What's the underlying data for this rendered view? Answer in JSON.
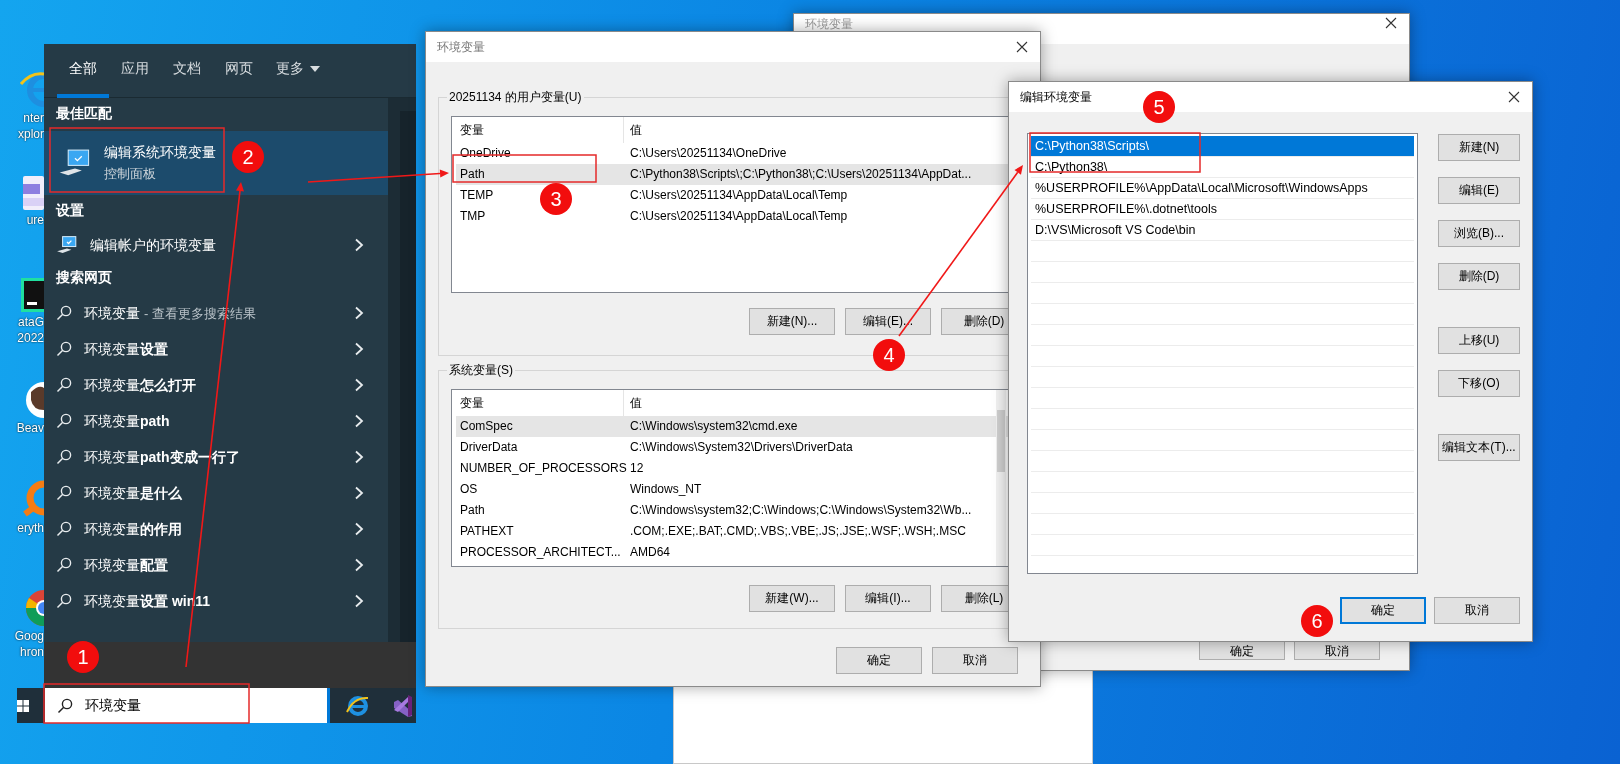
{
  "desktop": {
    "icons": [
      {
        "labels": [
          "nter",
          "xplor"
        ]
      },
      {
        "labels": [
          "ure"
        ]
      },
      {
        "labels": [
          "ataG",
          "2022"
        ]
      },
      {
        "labels": [
          "Beav"
        ]
      },
      {
        "labels": [
          "eryth"
        ]
      },
      {
        "labels": [
          "Goog",
          "hron"
        ]
      }
    ]
  },
  "start_menu": {
    "tabs": [
      {
        "label": "全部",
        "selected": true,
        "menu": false
      },
      {
        "label": "应用",
        "selected": false,
        "menu": false
      },
      {
        "label": "文档",
        "selected": false,
        "menu": false
      },
      {
        "label": "网页",
        "selected": false,
        "menu": false
      },
      {
        "label": "更多",
        "selected": false,
        "menu": true
      }
    ],
    "sections": [
      {
        "header": "最佳匹配",
        "kind": "best",
        "items": [
          {
            "title": "编辑系统环境变量",
            "subtitle": "控制面板",
            "selected": true
          }
        ]
      },
      {
        "header": "设置",
        "kind": "setting",
        "items": [
          {
            "title": "编辑帐户的环境变量"
          }
        ]
      },
      {
        "header": "搜索网页",
        "kind": "web",
        "items": [
          {
            "title": "环境变量",
            "hint": "- 查看更多搜索结果"
          },
          {
            "title": "环境变量**设置**"
          },
          {
            "title": "环境变量**怎么打开**"
          },
          {
            "title": "环境变量**path**"
          },
          {
            "title": "环境变量**path变成一行了**"
          },
          {
            "title": "环境变量**是什么**"
          },
          {
            "title": "环境变量**的作用**"
          },
          {
            "title": "环境变量**配置**"
          },
          {
            "title": "环境变量**设置 win11**"
          }
        ]
      }
    ]
  },
  "taskbar": {
    "search": {
      "value": "环境变量"
    }
  },
  "back_dialog": {
    "title": "环境变量",
    "buttons": [
      "确定",
      "取消"
    ]
  },
  "env_dialog": {
    "title": "环境变量",
    "user_group": {
      "label": "20251134 的用户变量(U)",
      "columns": [
        "变量",
        "值"
      ],
      "rows": [
        {
          "name": "OneDrive",
          "value": "C:\\Users\\20251134\\OneDrive",
          "selected": false
        },
        {
          "name": "Path",
          "value": "C:\\Python38\\Scripts\\;C:\\Python38\\;C:\\Users\\20251134\\AppDat...",
          "selected": true
        },
        {
          "name": "TEMP",
          "value": "C:\\Users\\20251134\\AppData\\Local\\Temp",
          "selected": false
        },
        {
          "name": "TMP",
          "value": "C:\\Users\\20251134\\AppData\\Local\\Temp",
          "selected": false
        }
      ],
      "buttons": [
        "新建(N)...",
        "编辑(E)...",
        "删除(D)"
      ]
    },
    "system_group": {
      "label": "系统变量(S)",
      "columns": [
        "变量",
        "值"
      ],
      "rows": [
        {
          "name": "ComSpec",
          "value": "C:\\Windows\\system32\\cmd.exe",
          "selected": true
        },
        {
          "name": "DriverData",
          "value": "C:\\Windows\\System32\\Drivers\\DriverData",
          "selected": false
        },
        {
          "name": "NUMBER_OF_PROCESSORS",
          "value": "12",
          "selected": false
        },
        {
          "name": "OS",
          "value": "Windows_NT",
          "selected": false
        },
        {
          "name": "Path",
          "value": "C:\\Windows\\system32;C:\\Windows;C:\\Windows\\System32\\Wb...",
          "selected": false
        },
        {
          "name": "PATHEXT",
          "value": ".COM;.EXE;.BAT;.CMD;.VBS;.VBE;.JS;.JSE;.WSF;.WSH;.MSC",
          "selected": false
        },
        {
          "name": "PROCESSOR_ARCHITECT...",
          "value": "AMD64",
          "selected": false
        }
      ],
      "buttons": [
        "新建(W)...",
        "编辑(I)...",
        "删除(L)"
      ]
    },
    "buttons": [
      "确定",
      "取消"
    ]
  },
  "edit_dialog": {
    "title": "编辑环境变量",
    "entries": [
      {
        "text": "C:\\Python38\\Scripts\\",
        "selected": true
      },
      {
        "text": "C:\\Python38\\",
        "selected": false
      },
      {
        "text": "%USERPROFILE%\\AppData\\Local\\Microsoft\\WindowsApps",
        "selected": false
      },
      {
        "text": "%USERPROFILE%\\.dotnet\\tools",
        "selected": false
      },
      {
        "text": "D:\\VS\\Microsoft VS Code\\bin",
        "selected": false
      }
    ],
    "side_buttons": [
      [
        "新建(N)",
        "编辑(E)",
        "浏览(B)...",
        "删除(D)"
      ],
      [
        "上移(U)",
        "下移(O)"
      ],
      [
        "编辑文本(T)..."
      ]
    ],
    "buttons": [
      {
        "label": "确定",
        "focused": true
      },
      {
        "label": "取消",
        "focused": false
      }
    ]
  },
  "annotations": [
    {
      "label": "1"
    },
    {
      "label": "2"
    },
    {
      "label": "3"
    },
    {
      "label": "4"
    },
    {
      "label": "5"
    },
    {
      "label": "6"
    }
  ]
}
